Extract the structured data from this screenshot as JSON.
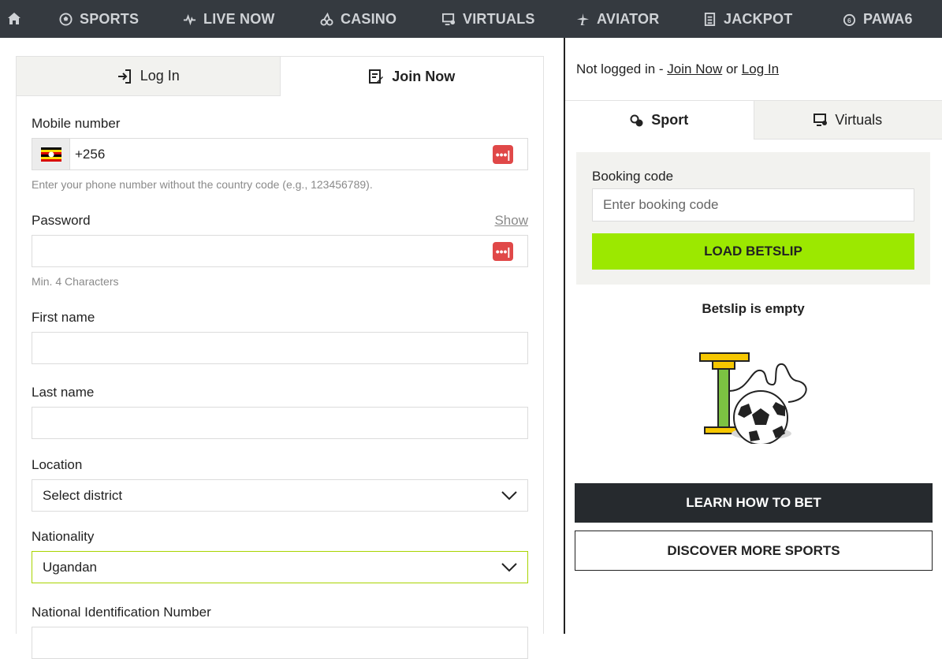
{
  "nav": {
    "items": [
      {
        "label": "SPORTS",
        "icon": "soccer-ball-icon"
      },
      {
        "label": "LIVE NOW",
        "icon": "pulse-icon"
      },
      {
        "label": "CASINO",
        "icon": "cherries-icon"
      },
      {
        "label": "VIRTUALS",
        "icon": "monitor-icon"
      },
      {
        "label": "AVIATOR",
        "icon": "plane-icon"
      },
      {
        "label": "JACKPOT",
        "icon": "ticket-icon"
      },
      {
        "label": "PAWA6",
        "icon": "six-ball-icon"
      }
    ]
  },
  "auth_tabs": {
    "login": "Log In",
    "join": "Join Now"
  },
  "form": {
    "mobile_label": "Mobile number",
    "mobile_value": "+256",
    "mobile_hint": "Enter your phone number without the country code (e.g., 123456789).",
    "password_label": "Password",
    "show_label": "Show",
    "password_hint": "Min. 4 Characters",
    "first_name_label": "First name",
    "last_name_label": "Last name",
    "location_label": "Location",
    "location_value": "Select district",
    "nationality_label": "Nationality",
    "nationality_value": "Ugandan",
    "nin_label": "National Identification Number"
  },
  "betslip": {
    "status_prefix": "Not logged in - ",
    "join_link": "Join Now",
    "or_text": " or ",
    "login_link": "Log In",
    "tab_sport": "Sport",
    "tab_virtuals": "Virtuals",
    "booking_label": "Booking code",
    "booking_placeholder": "Enter booking code",
    "load_button": "LOAD BETSLIP",
    "empty_text": "Betslip is empty",
    "learn_button": "LEARN HOW TO BET",
    "discover_button": "DISCOVER MORE SPORTS"
  },
  "colors": {
    "nav_bg": "#353a40",
    "accent_green": "#9ce800",
    "dark_button": "#262a2e",
    "nationality_border": "#a8d400",
    "pw_manager_red": "#e04848"
  }
}
